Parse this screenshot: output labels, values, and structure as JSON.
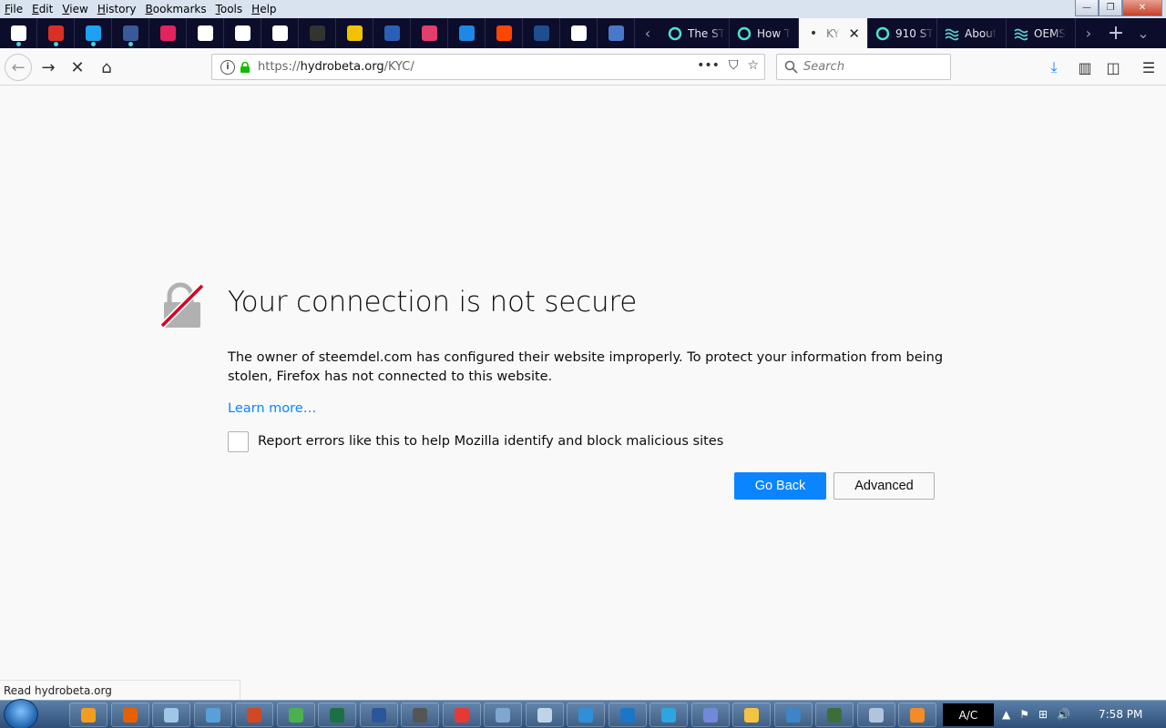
{
  "menu": [
    "File",
    "Edit",
    "View",
    "History",
    "Bookmarks",
    "Tools",
    "Help"
  ],
  "window_controls": {
    "minimize": "—",
    "restore": "❐",
    "close": "✕"
  },
  "pinned_tabs": [
    {
      "icon": "google-icon",
      "color": "#ffffff"
    },
    {
      "icon": "gmail-icon",
      "color": "#d93025"
    },
    {
      "icon": "twitter-icon",
      "color": "#1da1f2"
    },
    {
      "icon": "facebook-icon",
      "color": "#3b5998"
    },
    {
      "icon": "counter-icon",
      "color": "#e0245e"
    },
    {
      "icon": "document-icon",
      "color": "#ffffff"
    },
    {
      "icon": "globe-icon",
      "color": "#ffffff"
    },
    {
      "icon": "document-icon",
      "color": "#ffffff"
    },
    {
      "icon": "github-icon",
      "color": "#333333"
    },
    {
      "icon": "yellow-app-icon",
      "color": "#f2c200"
    },
    {
      "icon": "star-app-icon",
      "color": "#2b5fb5"
    },
    {
      "icon": "pink-app-icon",
      "color": "#e33e6d"
    },
    {
      "icon": "blue-app-icon",
      "color": "#1e88e5"
    },
    {
      "icon": "reddit-icon",
      "color": "#ff4500"
    },
    {
      "icon": "dark-app-icon",
      "color": "#1d4e8f"
    },
    {
      "icon": "medium-icon",
      "color": "#ffffff"
    },
    {
      "icon": "shield-app-icon",
      "color": "#4a78c8"
    }
  ],
  "tabs": [
    {
      "label": "The ST",
      "active": false
    },
    {
      "label": "How T",
      "active": false
    },
    {
      "label": "KY",
      "active": true,
      "close": "✕"
    },
    {
      "label": "910 ST",
      "active": false
    },
    {
      "label": "About",
      "active": false
    },
    {
      "label": "OEMS",
      "active": false
    }
  ],
  "new_tab_label": "+",
  "url": {
    "prefix": "https://",
    "domain": "hydrobeta.org",
    "path": "/KYC/"
  },
  "search_placeholder": "Search",
  "error": {
    "title": "Your connection is not secure",
    "description": "The owner of steemdel.com has configured their website improperly. To protect your information from being stolen, Firefox has not connected to this website.",
    "learn_more": "Learn more…",
    "report_label": "Report errors like this to help Mozilla identify and block malicious sites",
    "go_back": "Go Back",
    "advanced": "Advanced"
  },
  "status_text": "Read hydrobeta.org",
  "taskbar": {
    "apps": [
      {
        "icon": "media-player-icon",
        "color": "#f29d1f"
      },
      {
        "icon": "firefox-icon",
        "color": "#e66000"
      },
      {
        "icon": "notepad-icon",
        "color": "#9fc8e6"
      },
      {
        "icon": "circle-app-icon",
        "color": "#5aa0d8"
      },
      {
        "icon": "powerpoint-icon",
        "color": "#d24726"
      },
      {
        "icon": "chrome-icon",
        "color": "#4caf50"
      },
      {
        "icon": "excel-icon",
        "color": "#1d7044"
      },
      {
        "icon": "word-icon",
        "color": "#2b579a"
      },
      {
        "icon": "anchor-app-icon",
        "color": "#555555"
      },
      {
        "icon": "download-app-icon",
        "color": "#e53935"
      },
      {
        "icon": "keyboard-icon",
        "color": "#7fa8d0"
      },
      {
        "icon": "calculator-icon",
        "color": "#c0d4e8"
      },
      {
        "icon": "paint-icon",
        "color": "#2f8fd8"
      },
      {
        "icon": "edge-icon",
        "color": "#1b76c8"
      },
      {
        "icon": "telegram-icon",
        "color": "#2ca5e0"
      },
      {
        "icon": "discord-icon",
        "color": "#7289da"
      },
      {
        "icon": "folder-icon",
        "color": "#f5c342"
      },
      {
        "icon": "network-icon",
        "color": "#3d85c6"
      },
      {
        "icon": "terminal-icon",
        "color": "#3c6e3c"
      },
      {
        "icon": "settings-app-icon",
        "color": "#b0c4de"
      },
      {
        "icon": "orange-app-icon",
        "color": "#f28c28"
      }
    ],
    "ac_label": "A/C",
    "tray": [
      "▲",
      "⚑",
      "⊞",
      "🔊"
    ],
    "clock": "7:58 PM"
  }
}
